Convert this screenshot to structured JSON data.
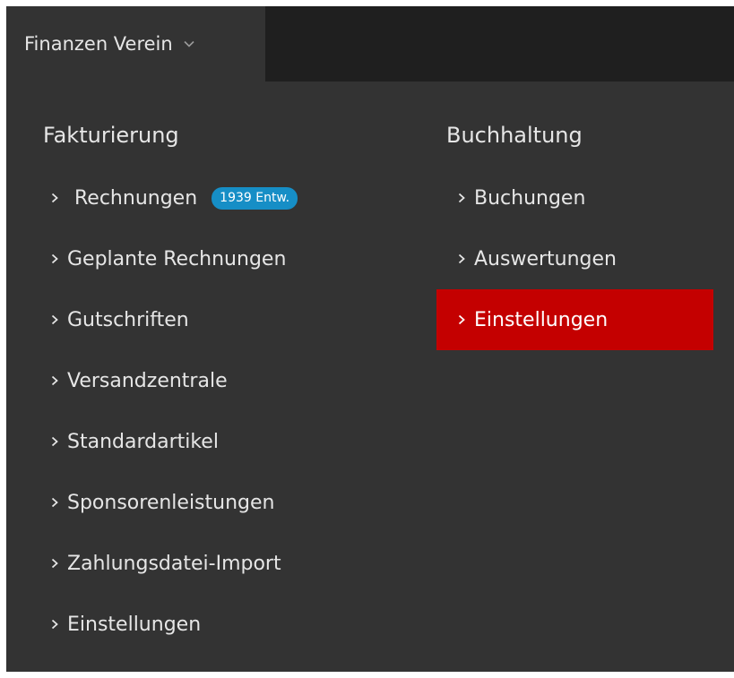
{
  "topbar": {
    "title": "Finanzen Verein",
    "dropdown_icon": "chevron-down-icon"
  },
  "left_column": {
    "heading": "Fakturierung",
    "items": [
      {
        "label": "Rechnungen",
        "badge": "1939 Entw."
      },
      {
        "label": "Geplante Rechnungen"
      },
      {
        "label": "Gutschriften"
      },
      {
        "label": "Versandzentrale"
      },
      {
        "label": "Standardartikel"
      },
      {
        "label": "Sponsorenleistungen"
      },
      {
        "label": "Zahlungsdatei-Import"
      },
      {
        "label": "Einstellungen"
      }
    ]
  },
  "right_column": {
    "heading": "Buchhaltung",
    "items": [
      {
        "label": "Buchungen"
      },
      {
        "label": "Auswertungen"
      },
      {
        "label": "Einstellungen",
        "active": true
      }
    ]
  },
  "colors": {
    "menu_background": "#333333",
    "topbar_background": "#1f1f1f",
    "text": "#e6e6e6",
    "active_background": "#c40000",
    "badge_background": "#168ec6"
  },
  "icons": {
    "item_arrow": "chevron-right-icon"
  }
}
